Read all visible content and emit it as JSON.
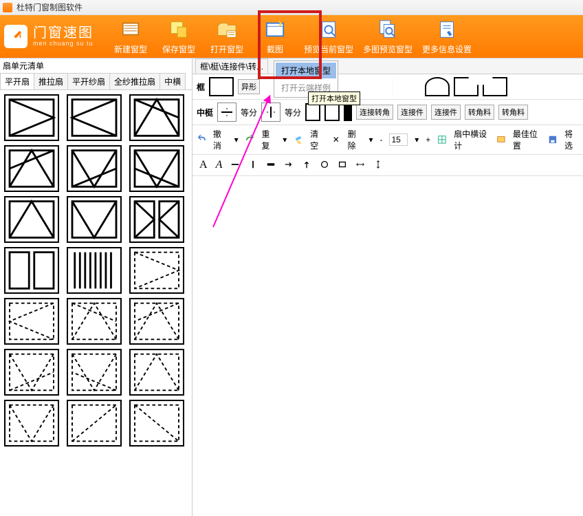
{
  "titlebar": {
    "title": "杜特门窗制图软件"
  },
  "brand": {
    "cn": "门窗速图",
    "py": "men chuang su tu"
  },
  "ribbon": [
    {
      "key": "new",
      "label": "新建窗型"
    },
    {
      "key": "save",
      "label": "保存窗型"
    },
    {
      "key": "open",
      "label": "打开窗型"
    },
    {
      "key": "capture",
      "label": "截图"
    },
    {
      "key": "preview",
      "label": "预览当前窗型"
    },
    {
      "key": "multi",
      "label": "多图预览窗型"
    },
    {
      "key": "more",
      "label": "更多信息设置"
    }
  ],
  "sidebar": {
    "title": "扇单元清单",
    "tabs": [
      "平开扇",
      "推拉扇",
      "平开纱扇",
      "全纱推拉扇",
      "中横"
    ]
  },
  "right": {
    "tabs": [
      "框\\梃\\连接件\\转..."
    ],
    "frame_label": "框",
    "mullion_label": "中梃",
    "mid_labels": [
      "等分",
      "等分"
    ],
    "btn_connect": "连接转角",
    "btn_conn2": "连接件",
    "btn_conn3": "连接件",
    "btn_corner": "转角料",
    "btn_corner2": "转角料"
  },
  "toolbar2": {
    "undo": "撤消",
    "redo": "重复",
    "clear": "清空",
    "delete": "删除",
    "number": "15",
    "shan": "扇中横设计",
    "best": "最佳位置",
    "extra": "将选"
  },
  "toolbar3": {
    "a1": "A",
    "a2": "A"
  },
  "dropdown": {
    "item1": "打开本地窗型",
    "item2": "打开云端样例"
  },
  "tooltip": "打开本地窗型",
  "frame_btn_yixing": "异形"
}
